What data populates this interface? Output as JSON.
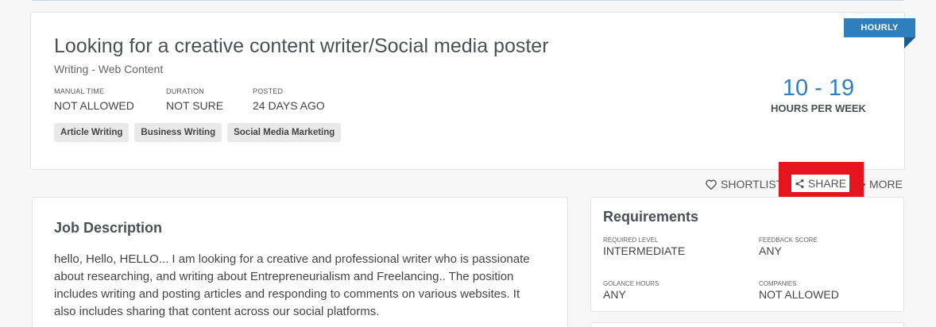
{
  "job": {
    "title": "Looking for a creative content writer/Social media poster",
    "category": "Writing - Web Content",
    "meta": [
      {
        "label": "MANUAL TIME",
        "value": "NOT ALLOWED"
      },
      {
        "label": "DURATION",
        "value": "NOT SURE"
      },
      {
        "label": "POSTED",
        "value": "24 DAYS AGO"
      }
    ],
    "tags": [
      "Article Writing",
      "Business Writing",
      "Social Media Marketing"
    ],
    "badge": "HOURLY",
    "hours_range": "10 - 19",
    "hours_unit": "HOURS PER WEEK"
  },
  "actions": {
    "shortlist": "SHORTLIST",
    "share": "SHARE",
    "more": "MORE"
  },
  "description": {
    "title": "Job Description",
    "text": "hello, Hello, HELLO... I am looking for a creative and professional writer who is passionate about researching, and writing about Entrepreneurialism and Freelancing.. The position includes writing and posting articles and responding to comments on various websites. It also includes sharing that content across our social platforms."
  },
  "requirements": {
    "title": "Requirements",
    "items": [
      {
        "label": "REQUIRED LEVEL",
        "value": "INTERMEDIATE"
      },
      {
        "label": "FEEDBACK SCORE",
        "value": "ANY"
      },
      {
        "label": "GOLANCE HOURS",
        "value": "ANY"
      },
      {
        "label": "COMPANIES",
        "value": "NOT ALLOWED"
      }
    ]
  },
  "colors": {
    "accent": "#2f7fbd",
    "highlight": "#e5141f"
  }
}
